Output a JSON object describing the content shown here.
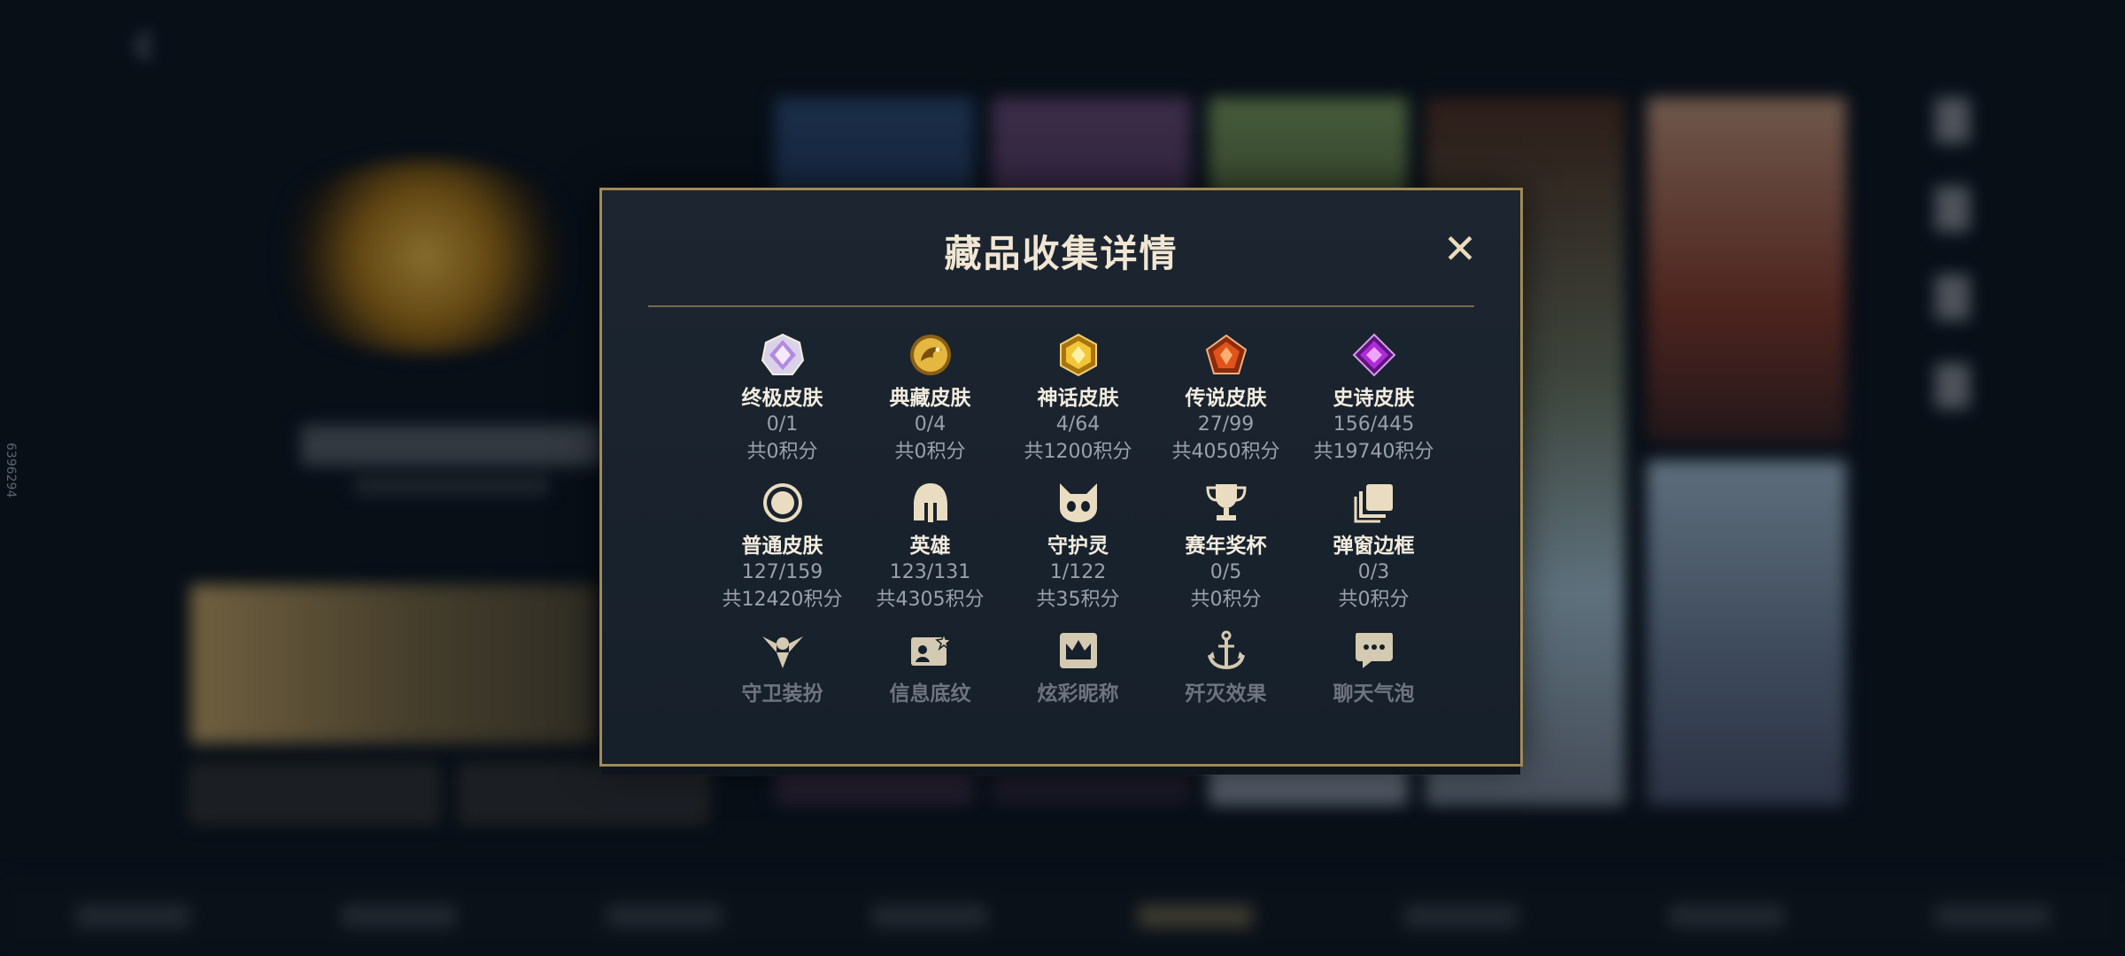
{
  "background": {
    "side_number": "6396294"
  },
  "modal": {
    "title": "藏品收集详情",
    "close_label": "✕",
    "items": [
      {
        "name": "终极皮肤",
        "count": "0/1",
        "points": "共0积分",
        "icon": "ultimate-gem-icon"
      },
      {
        "name": "典藏皮肤",
        "count": "0/4",
        "points": "共0积分",
        "icon": "dragon-medallion-icon"
      },
      {
        "name": "神话皮肤",
        "count": "4/64",
        "points": "共1200积分",
        "icon": "mythic-gem-icon"
      },
      {
        "name": "传说皮肤",
        "count": "27/99",
        "points": "共4050积分",
        "icon": "legendary-gem-icon"
      },
      {
        "name": "史诗皮肤",
        "count": "156/445",
        "points": "共19740积分",
        "icon": "epic-gem-icon"
      },
      {
        "name": "普通皮肤",
        "count": "127/159",
        "points": "共12420积分",
        "icon": "circle-icon"
      },
      {
        "name": "英雄",
        "count": "123/131",
        "points": "共4305积分",
        "icon": "helmet-icon"
      },
      {
        "name": "守护灵",
        "count": "1/122",
        "points": "共35积分",
        "icon": "little-legend-icon"
      },
      {
        "name": "赛年奖杯",
        "count": "0/5",
        "points": "共0积分",
        "icon": "trophy-icon"
      },
      {
        "name": "弹窗边框",
        "count": "0/3",
        "points": "共0积分",
        "icon": "frames-icon"
      },
      {
        "name": "守卫装扮",
        "icon": "ward-icon"
      },
      {
        "name": "信息底纹",
        "icon": "profile-banner-icon"
      },
      {
        "name": "炫彩昵称",
        "icon": "crown-icon"
      },
      {
        "name": "歼灭效果",
        "icon": "anchor-icon"
      },
      {
        "name": "聊天气泡",
        "icon": "chat-bubble-icon"
      }
    ]
  },
  "colors": {
    "gold_border": "#a08a57",
    "title_text": "#f0e6d2",
    "muted_text": "#9aa1aa"
  }
}
